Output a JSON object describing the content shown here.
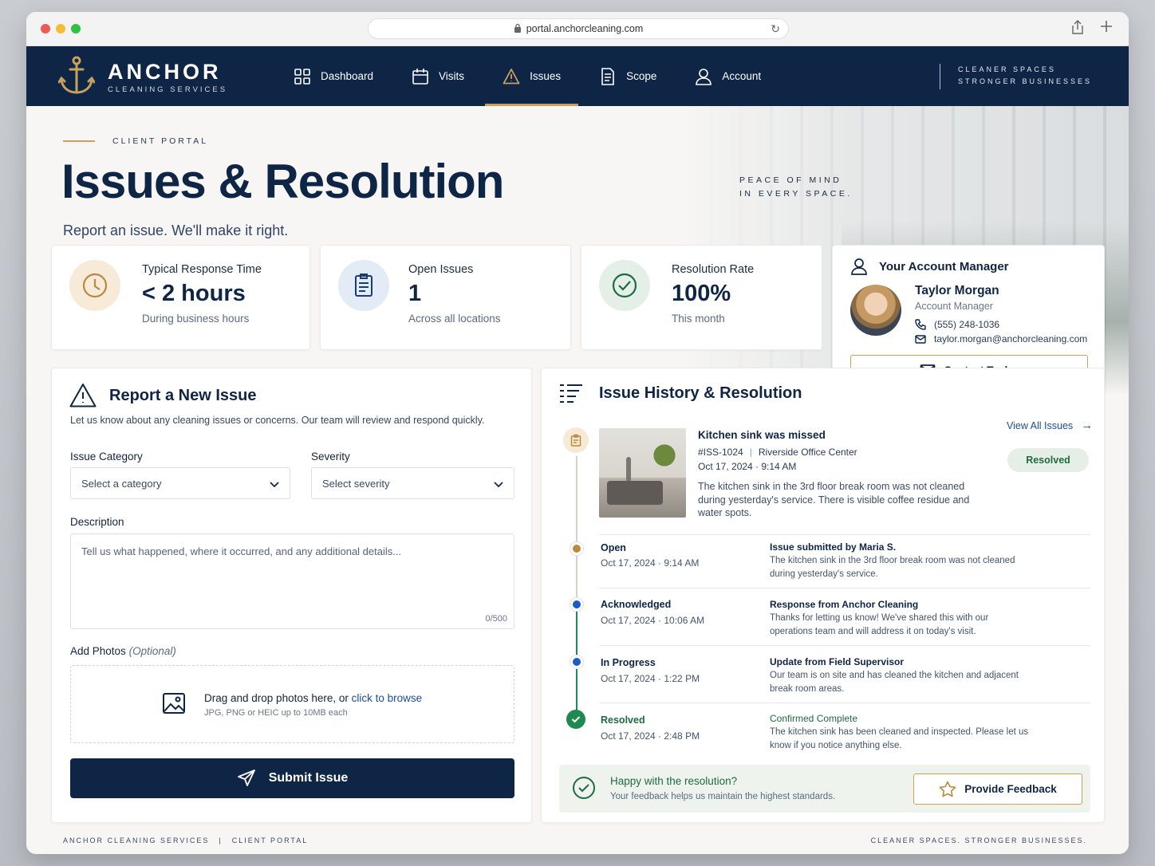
{
  "browser": {
    "url": "portal.anchorcleaning.com"
  },
  "brand": {
    "name": "ANCHOR",
    "subtitle": "CLEANING SERVICES",
    "tagline_line1": "CLEANER SPACES",
    "tagline_line2": "STRONGER BUSINESSES"
  },
  "nav": {
    "items": [
      {
        "label": "Dashboard",
        "icon": "dashboard-grid-icon"
      },
      {
        "label": "Visits",
        "icon": "calendar-icon"
      },
      {
        "label": "Issues",
        "icon": "warning-icon",
        "active": true
      },
      {
        "label": "Scope",
        "icon": "document-icon"
      },
      {
        "label": "Account",
        "icon": "user-icon"
      }
    ]
  },
  "hero": {
    "eyebrow": "CLIENT PORTAL",
    "title": "Issues & Resolution",
    "subtitle": "Report an issue. We'll make it right.",
    "peace_line1": "PEACE OF MIND",
    "peace_line2": "IN EVERY SPACE."
  },
  "stats": [
    {
      "label": "Typical Response Time",
      "value": "< 2 hours",
      "note": "During business hours",
      "icon": "clock-icon"
    },
    {
      "label": "Open Issues",
      "value": "1",
      "note": "Across all locations",
      "icon": "clipboard-icon"
    },
    {
      "label": "Resolution Rate",
      "value": "100%",
      "note": "This month",
      "icon": "check-circle-icon"
    }
  ],
  "manager": {
    "heading": "Your Account Manager",
    "name": "Taylor Morgan",
    "role": "Account Manager",
    "phone": "(555) 248-1036",
    "email": "taylor.morgan@anchorcleaning.com",
    "button": "Contact Taylor"
  },
  "form": {
    "title": "Report a New Issue",
    "description": "Let us know about any cleaning issues or concerns. Our team will review and respond quickly.",
    "category_label": "Issue Category",
    "category_value": "Select a category",
    "severity_label": "Severity",
    "severity_value": "Select severity",
    "description_label": "Description",
    "description_placeholder": "Tell us what happened, where it occurred, and any additional details...",
    "counter": "0/500",
    "photos_label": "Add Photos",
    "photos_optional": "(Optional)",
    "dropzone_text": "Drag and drop photos here, or ",
    "dropzone_link": "click to browse",
    "dropzone_sub": "JPG, PNG or HEIC up to 10MB each",
    "submit": "Submit Issue"
  },
  "history": {
    "title": "Issue History & Resolution",
    "view_all": "View All Issues",
    "issue": {
      "title": "Kitchen sink was missed",
      "id": "#ISS-1024",
      "location": "Riverside Office Center",
      "date": "Oct 17, 2024 · 9:14 AM",
      "description": "The kitchen sink in the 3rd floor break room was not cleaned during yesterday's service. There is visible coffee residue and water spots.",
      "status": "Resolved"
    },
    "timeline": [
      {
        "status": "Open",
        "date": "Oct 17, 2024  ·  9:14 AM",
        "head": "Issue submitted by Maria S.",
        "body": "The kitchen sink in the 3rd floor break room was not cleaned during yesterday's service.",
        "color": "#b98a3e"
      },
      {
        "status": "Acknowledged",
        "date": "Oct 17, 2024  ·  10:06 AM",
        "head": "Response from Anchor Cleaning",
        "body": "Thanks for letting us know! We've shared this with our operations team and will address it on today's visit.",
        "color": "#1a5cc8"
      },
      {
        "status": "In Progress",
        "date": "Oct 17, 2024  ·  1:22 PM",
        "head": "Update from Field Supervisor",
        "body": "Our team is on site and has cleaned the kitchen and adjacent break room areas.",
        "color": "#1a5cc8"
      },
      {
        "status": "Resolved",
        "date": "Oct 17, 2024  ·  2:48 PM",
        "head": "Confirmed Complete",
        "body": "The kitchen sink has been cleaned and inspected. Please let us know if you notice anything else.",
        "color": "#1f8a4f"
      }
    ],
    "feedback": {
      "question": "Happy with the resolution?",
      "sub": "Your feedback helps us maintain the highest standards.",
      "button": "Provide Feedback"
    }
  },
  "footer": {
    "left1": "ANCHOR CLEANING SERVICES",
    "left_sep": "|",
    "left2": "CLIENT PORTAL",
    "right": "CLEANER SPACES. STRONGER BUSINESSES."
  }
}
